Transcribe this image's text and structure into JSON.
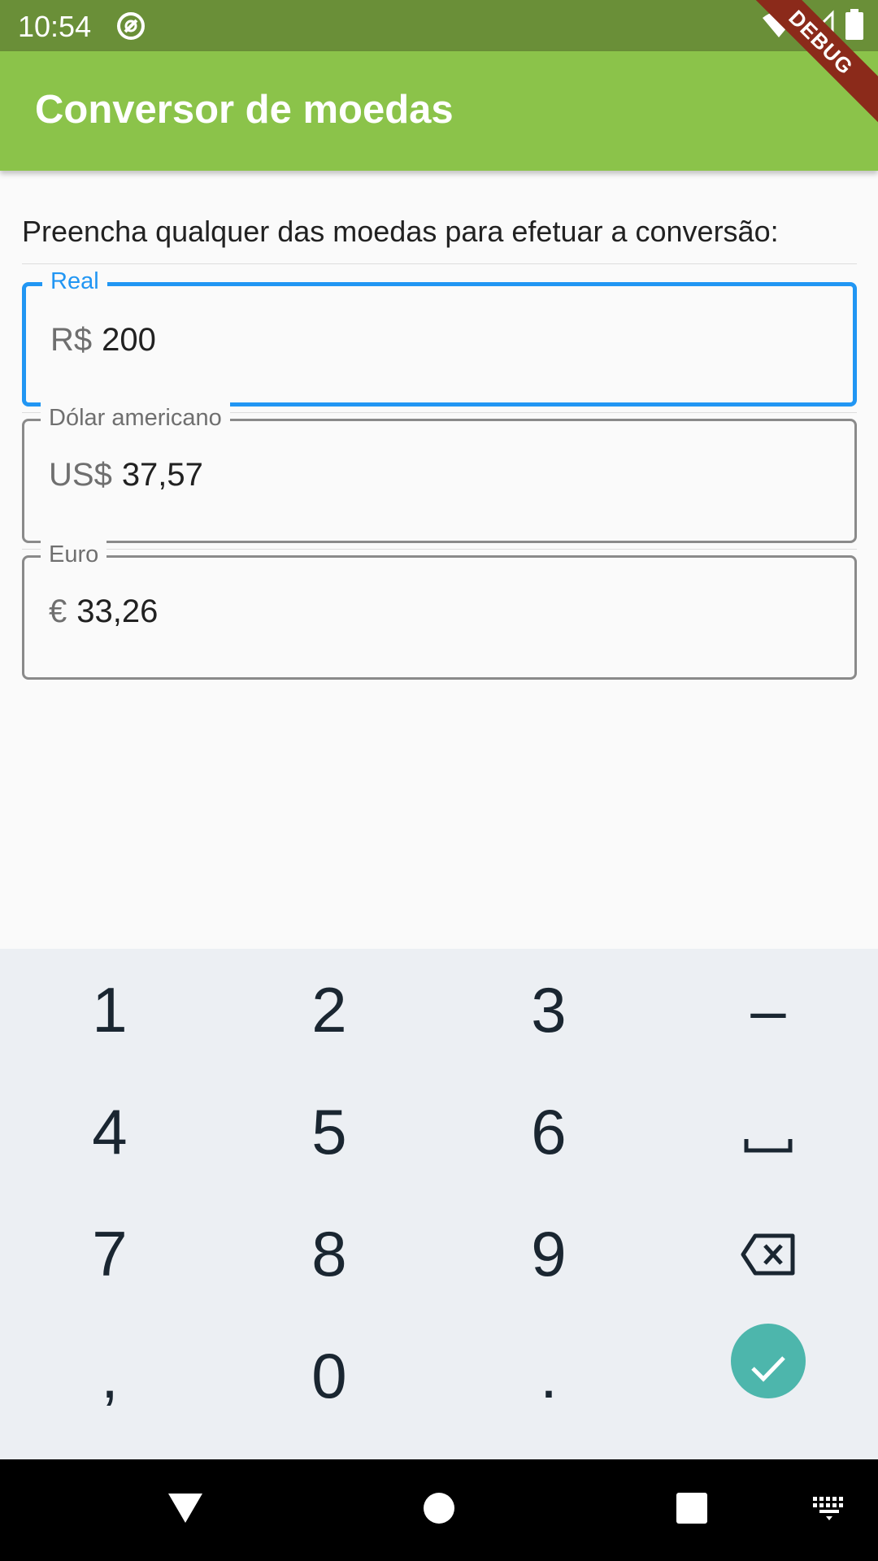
{
  "status_bar": {
    "time": "10:54",
    "app_icon": "app-notification-icon",
    "icons": [
      "wifi-icon",
      "signal-icon",
      "battery-icon"
    ]
  },
  "debug_banner": "DEBUG",
  "app_bar": {
    "title": "Conversor de moedas"
  },
  "instruction": "Preencha qualquer das moedas para efetuar a conversão:",
  "fields": [
    {
      "label": "Real",
      "prefix": "R$",
      "value": "200",
      "focused": true
    },
    {
      "label": "Dólar americano",
      "prefix": "US$",
      "value": "37,57",
      "focused": false
    },
    {
      "label": "Euro",
      "prefix": "€",
      "value": "33,26",
      "focused": false
    }
  ],
  "keyboard": {
    "rows": [
      [
        "1",
        "2",
        "3",
        "–"
      ],
      [
        "4",
        "5",
        "6",
        "space"
      ],
      [
        "7",
        "8",
        "9",
        "backspace"
      ],
      [
        ",",
        "0",
        ".",
        "done"
      ]
    ],
    "accent_color": "#4db6ac"
  },
  "nav_bar": {
    "icons": [
      "back-icon",
      "home-icon",
      "recents-icon",
      "keyboard-switch-icon"
    ]
  },
  "colors": {
    "primary": "#8bc34a",
    "status_bar": "#6a8f38",
    "focus": "#2196f3"
  }
}
